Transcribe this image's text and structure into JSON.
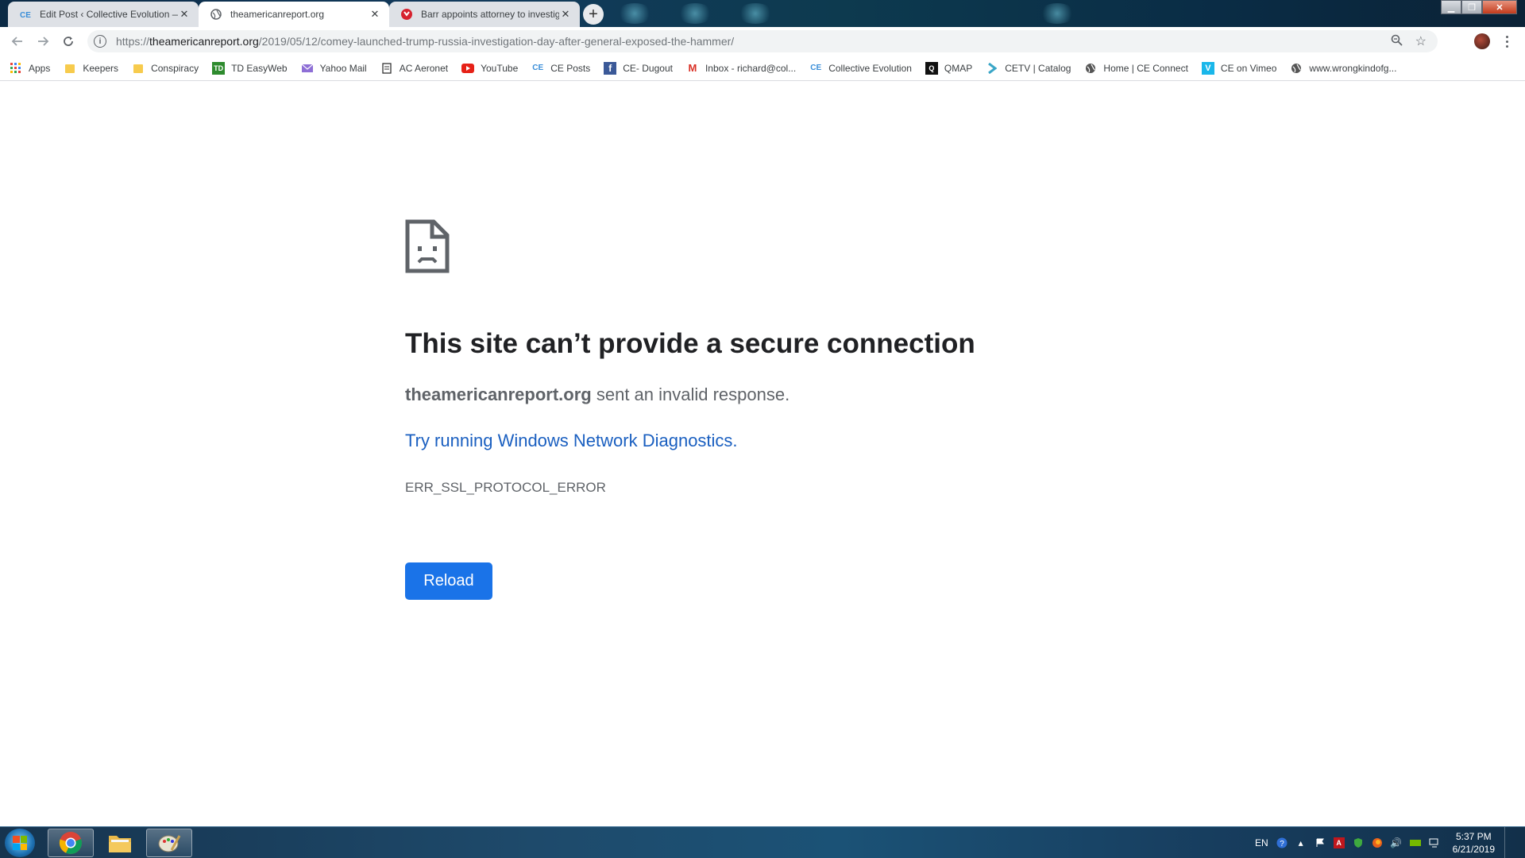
{
  "tabs": [
    {
      "title": "Edit Post ‹ Collective Evolution —",
      "favicon": "ce-logo-icon",
      "active": false
    },
    {
      "title": "theamericanreport.org",
      "favicon": "globe-icon",
      "active": true
    },
    {
      "title": "Barr appoints attorney to investig",
      "favicon": "error-badge-icon",
      "active": false
    }
  ],
  "toolbar": {
    "url_scheme": "https://",
    "url_host": "theamericanreport.org",
    "url_path": "/2019/05/12/comey-launched-trump-russia-investigation-day-after-general-exposed-the-hammer/"
  },
  "bookmarks": [
    {
      "label": "Apps",
      "icon": "apps-grid-icon",
      "color": "#e8453c"
    },
    {
      "label": "Keepers",
      "icon": "folder-icon",
      "color": "#f7cb4d"
    },
    {
      "label": "Conspiracy",
      "icon": "folder-icon",
      "color": "#f7cb4d"
    },
    {
      "label": "TD EasyWeb",
      "icon": "td-logo-icon",
      "color": "#2e8b2e"
    },
    {
      "label": "Yahoo Mail",
      "icon": "mail-icon",
      "color": "#6b3fa0"
    },
    {
      "label": "AC Aeronet",
      "icon": "page-icon",
      "color": "#333333"
    },
    {
      "label": "YouTube",
      "icon": "youtube-icon",
      "color": "#e62117"
    },
    {
      "label": "CE Posts",
      "icon": "ce-logo-icon",
      "color": "#3a8ed8"
    },
    {
      "label": "CE- Dugout",
      "icon": "facebook-icon",
      "color": "#3b5998"
    },
    {
      "label": "Inbox - richard@col...",
      "icon": "gmail-icon",
      "color": "#d93025"
    },
    {
      "label": "Collective Evolution",
      "icon": "ce-logo-icon",
      "color": "#3a8ed8"
    },
    {
      "label": "QMAP",
      "icon": "qmap-icon",
      "color": "#111111"
    },
    {
      "label": "CETV | Catalog",
      "icon": "chevron-right-icon",
      "color": "#3aa6c7"
    },
    {
      "label": "Home | CE Connect",
      "icon": "globe-icon",
      "color": "#555555"
    },
    {
      "label": "CE on Vimeo",
      "icon": "vimeo-icon",
      "color": "#1ab7ea"
    },
    {
      "label": "www.wrongkindofg...",
      "icon": "globe-icon",
      "color": "#555555"
    }
  ],
  "error_page": {
    "title": "This site can’t provide a secure connection",
    "host": "theamericanreport.org",
    "detail_suffix": " sent an invalid response.",
    "diagnostics_link": "Try running Windows Network Diagnostics.",
    "error_code": "ERR_SSL_PROTOCOL_ERROR",
    "reload_label": "Reload",
    "reload_color": "#1a73e8"
  },
  "taskbar": {
    "apps": [
      {
        "name": "chrome",
        "icon": "chrome-icon",
        "active": true
      },
      {
        "name": "file-explorer",
        "icon": "folder-icon",
        "active": false
      },
      {
        "name": "paint",
        "icon": "paint-icon",
        "active": true
      }
    ],
    "language": "EN",
    "time": "5:37 PM",
    "date": "6/21/2019"
  }
}
